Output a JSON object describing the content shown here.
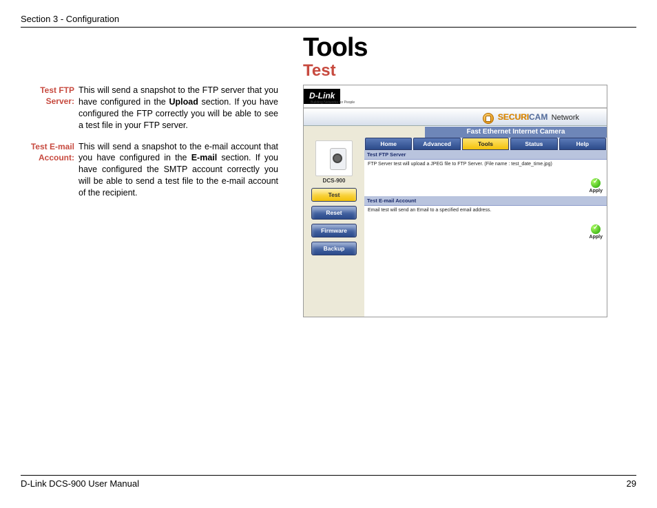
{
  "header": {
    "section_label": "Section 3 - Configuration"
  },
  "title": {
    "main": "Tools",
    "sub": "Test"
  },
  "definitions": [
    {
      "label": "Test FTP Server:",
      "text_pre": "This will send a snapshot to the FTP server that you have configured in the ",
      "bold1": "Upload",
      "text_post": " section. If you have configured the FTP correctly you will be able to see a test file in your FTP server."
    },
    {
      "label": "Test E-mail Account:",
      "text_pre": "This will send a snapshot to the e-mail account that you have configured in the ",
      "bold1": "E-mail",
      "text_post": " section. If you have configured the SMTP account correctly you will be able to send a test file to the e-mail account of the recipient."
    }
  ],
  "ui": {
    "brand": "D-Link",
    "brand_tag": "Building Networks for People",
    "hero_s": "SECURI",
    "hero_c": "CAM",
    "hero_n": "Network",
    "sub_band": "Fast Ethernet Internet Camera",
    "cam_model": "DCS-900",
    "tabs": [
      {
        "label": "Home",
        "style": "blue"
      },
      {
        "label": "Advanced",
        "style": "blue"
      },
      {
        "label": "Tools",
        "style": "yellow"
      },
      {
        "label": "Status",
        "style": "blue"
      },
      {
        "label": "Help",
        "style": "blue"
      }
    ],
    "side_buttons": [
      {
        "label": "Test",
        "style": "yellow"
      },
      {
        "label": "Reset",
        "style": "blue"
      },
      {
        "label": "Firmware",
        "style": "blue"
      },
      {
        "label": "Backup",
        "style": "blue"
      }
    ],
    "sections": [
      {
        "header": "Test FTP Server",
        "body": "FTP Server test will upload a JPEG file to FTP Server. (File name : test_date_time.jpg)",
        "apply": "Apply"
      },
      {
        "header": "Test E-mail Account",
        "body": "Email test will send an Email to a specified email address.",
        "apply": "Apply"
      }
    ]
  },
  "footer": {
    "left": "D-Link DCS-900 User Manual",
    "right": "29"
  }
}
